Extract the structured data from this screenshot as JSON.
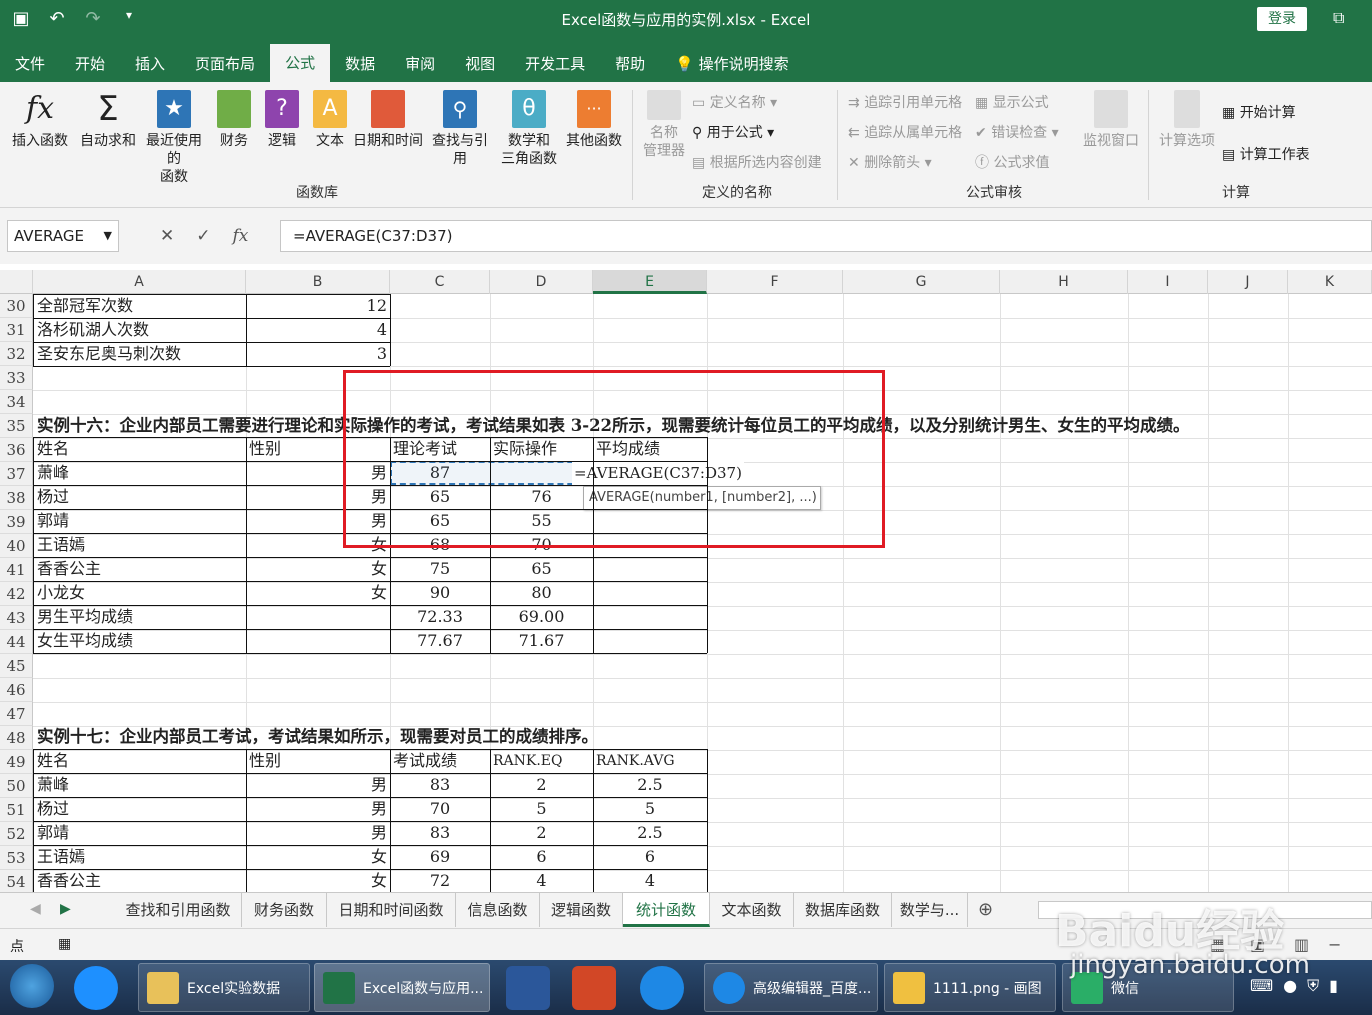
{
  "window": {
    "title": "Excel函数与应用的实例.xlsx  -  Excel",
    "login": "登录"
  },
  "tabs": [
    "文件",
    "开始",
    "插入",
    "页面布局",
    "公式",
    "数据",
    "审阅",
    "视图",
    "开发工具",
    "帮助",
    "操作说明搜索"
  ],
  "ribbon": {
    "buttons": [
      "插入函数",
      "自动求和",
      "最近使用的\n函数",
      "财务",
      "逻辑",
      "文本",
      "日期和时间",
      "查找与引用",
      "数学和\n三角函数",
      "其他函数"
    ],
    "group_funclib": "函数库",
    "names_manager": "名称\n管理器",
    "define_name": "定义名称",
    "use_in_formula": "用于公式",
    "create_from_sel": "根据所选内容创建",
    "group_names": "定义的名称",
    "trace_prec": "追踪引用单元格",
    "trace_dep": "追踪从属单元格",
    "remove_arrows": "删除箭头",
    "show_formulas": "显示公式",
    "error_check": "错误检查",
    "eval_formula": "公式求值",
    "watch": "监视窗口",
    "group_audit": "公式审核",
    "calc_options": "计算选项",
    "calc_now": "开始计算",
    "calc_sheet": "计算工作表",
    "group_calc": "计算"
  },
  "formula_bar": {
    "name_box": "AVERAGE",
    "formula": "=AVERAGE(C37:D37)"
  },
  "columns": [
    "A",
    "B",
    "C",
    "D",
    "E",
    "F",
    "G",
    "H",
    "I",
    "J",
    "K"
  ],
  "rows": [
    "30",
    "31",
    "32",
    "33",
    "34",
    "35",
    "36",
    "37",
    "38",
    "39",
    "40",
    "41",
    "42",
    "43",
    "44",
    "45",
    "46",
    "47",
    "48",
    "49",
    "50",
    "51",
    "52",
    "53",
    "54"
  ],
  "sheet": {
    "r30": [
      "全部冠军次数",
      "12"
    ],
    "r31": [
      "洛杉矶湖人次数",
      "4"
    ],
    "r32": [
      "圣安东尼奥马刺次数",
      "3"
    ],
    "r35": "实例十六：企业内部员工需要进行理论和实际操作的考试，考试结果如表 3-22所示，现需要统计每位员工的平均成绩，以及分别统计男生、女生的平均成绩。",
    "t1_header": [
      "姓名",
      "性别",
      "理论考试",
      "实际操作",
      "平均成绩"
    ],
    "t1_rows": [
      [
        "萧峰",
        "男",
        "87",
        ""
      ],
      [
        "杨过",
        "男",
        "65",
        "76"
      ],
      [
        "郭靖",
        "男",
        "65",
        "55"
      ],
      [
        "王语嫣",
        "女",
        "68",
        "70"
      ],
      [
        "香香公主",
        "女",
        "75",
        "65"
      ],
      [
        "小龙女",
        "女",
        "90",
        "80"
      ]
    ],
    "t1_avg": [
      [
        "男生平均成绩",
        "72.33",
        "69.00"
      ],
      [
        "女生平均成绩",
        "77.67",
        "71.67"
      ]
    ],
    "editing_cell": "=AVERAGE(C37:D37)",
    "tooltip": "AVERAGE(number1, [number2], ...)",
    "r48": "实例十七：企业内部员工考试，考试结果如所示，现需要对员工的成绩排序。",
    "t2_header": [
      "姓名",
      "性别",
      "考试成绩",
      "RANK.EQ",
      "RANK.AVG"
    ],
    "t2_rows": [
      [
        "萧峰",
        "男",
        "83",
        "2",
        "2.5"
      ],
      [
        "杨过",
        "男",
        "70",
        "5",
        "5"
      ],
      [
        "郭靖",
        "男",
        "83",
        "2",
        "2.5"
      ],
      [
        "王语嫣",
        "女",
        "69",
        "6",
        "6"
      ],
      [
        "香香公主",
        "女",
        "72",
        "4",
        "4"
      ]
    ]
  },
  "sheet_tabs": [
    "查找和引用函数",
    "财务函数",
    "日期和时间函数",
    "信息函数",
    "逻辑函数",
    "统计函数",
    "文本函数",
    "数据库函数",
    "数学与..."
  ],
  "status": {
    "mode": "点"
  },
  "taskbar": [
    "Excel实验数据",
    "Excel函数与应用...",
    "高级编辑器_百度...",
    "1111.png - 画图",
    "微信"
  ],
  "watermark": [
    "Baidu经验",
    "jingyan.baidu.com"
  ]
}
